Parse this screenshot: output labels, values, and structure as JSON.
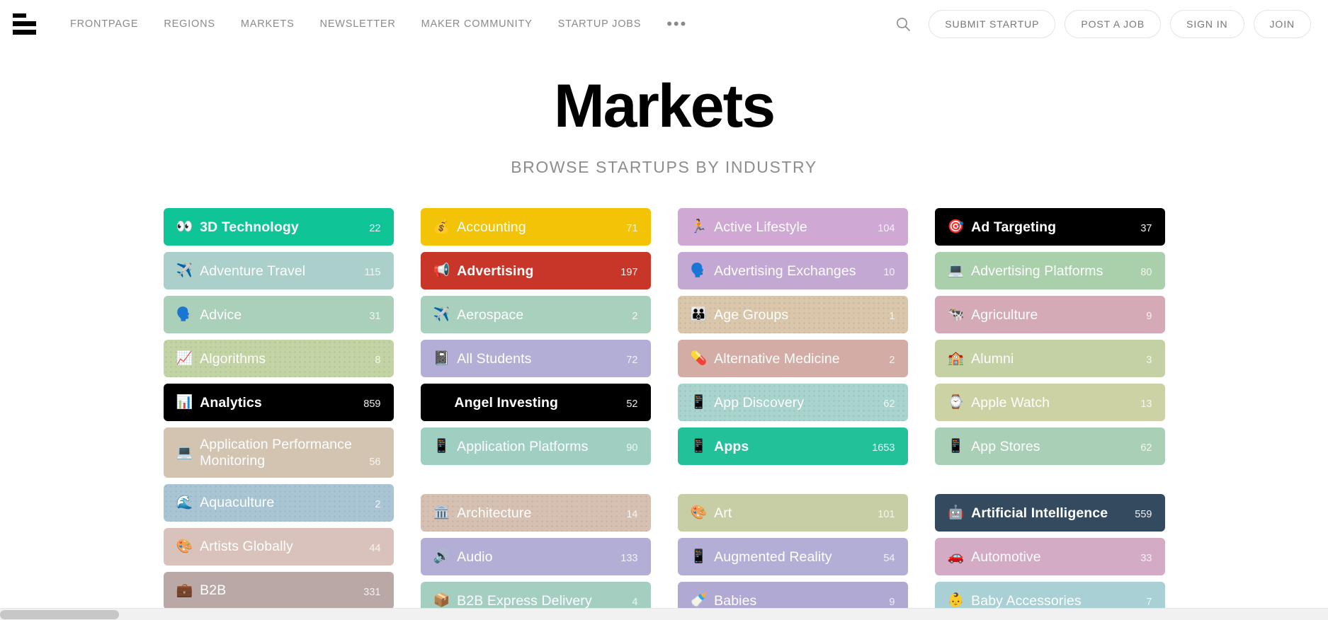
{
  "header": {
    "menu_icon": "hamburger-icon",
    "nav": [
      {
        "label": "FRONTPAGE"
      },
      {
        "label": "REGIONS"
      },
      {
        "label": "MARKETS"
      },
      {
        "label": "NEWSLETTER"
      },
      {
        "label": "MAKER COMMUNITY"
      },
      {
        "label": "STARTUP JOBS"
      }
    ],
    "more_label": "•••",
    "search_icon": "search-icon",
    "actions": [
      {
        "label": "SUBMIT STARTUP"
      },
      {
        "label": "POST A JOB"
      },
      {
        "label": "SIGN IN"
      },
      {
        "label": "JOIN"
      }
    ]
  },
  "page": {
    "title": "Markets",
    "subtitle": "BROWSE STARTUPS BY INDUSTRY"
  },
  "columns": [
    {
      "cards": [
        {
          "emoji": "👀",
          "icon": "eyes-icon",
          "label": "3D Technology",
          "count": "22",
          "bg": "#0fc496",
          "bold": true,
          "dotted": false,
          "spaced": false
        },
        {
          "emoji": "✈️",
          "icon": "airplane-icon",
          "label": "Adventure Travel",
          "count": "115",
          "bg": "#abcfca",
          "bold": false,
          "dotted": false,
          "spaced": false
        },
        {
          "emoji": "🗣️",
          "icon": "speaking-head-icon",
          "label": "Advice",
          "count": "31",
          "bg": "#abd0b9",
          "bold": false,
          "dotted": false,
          "spaced": false
        },
        {
          "emoji": "📈",
          "icon": "chart-increasing-icon",
          "label": "Algorithms",
          "count": "8",
          "bg": "#c2d3a4",
          "bold": false,
          "dotted": true,
          "spaced": false
        },
        {
          "emoji": "📊",
          "icon": "bar-chart-icon",
          "label": "Analytics",
          "count": "859",
          "bg": "#000000",
          "bold": true,
          "dotted": false,
          "spaced": false
        },
        {
          "emoji": "💻",
          "icon": "laptop-icon",
          "label": "Application Performance Monitoring",
          "count": "56",
          "bg": "#d3c3b1",
          "bold": false,
          "dotted": false,
          "spaced": false
        },
        {
          "emoji": "🌊",
          "icon": "wave-icon",
          "label": "Aquaculture",
          "count": "2",
          "bg": "#a9c5d4",
          "bold": false,
          "dotted": true,
          "spaced": false
        },
        {
          "emoji": "🎨",
          "icon": "palette-icon",
          "label": "Artists Globally",
          "count": "44",
          "bg": "#d9c2bc",
          "bold": false,
          "dotted": false,
          "spaced": false
        },
        {
          "emoji": "💼",
          "icon": "briefcase-icon",
          "label": "B2B",
          "count": "331",
          "bg": "#b9a8a5",
          "bold": false,
          "dotted": false,
          "spaced": false
        }
      ]
    },
    {
      "cards": [
        {
          "emoji": "💰",
          "icon": "money-bag-icon",
          "label": "Accounting",
          "count": "71",
          "bg": "#f2c307",
          "bold": false,
          "dotted": false,
          "spaced": false
        },
        {
          "emoji": "📢",
          "icon": "megaphone-icon",
          "label": "Advertising",
          "count": "197",
          "bg": "#c8362a",
          "bold": true,
          "dotted": false,
          "spaced": false
        },
        {
          "emoji": "✈️",
          "icon": "airplane-icon",
          "label": "Aerospace",
          "count": "2",
          "bg": "#a9cfbd",
          "bold": false,
          "dotted": false,
          "spaced": false
        },
        {
          "emoji": "📓",
          "icon": "notebook-icon",
          "label": "All Students",
          "count": "72",
          "bg": "#b3aed6",
          "bold": false,
          "dotted": false,
          "spaced": false
        },
        {
          "emoji": "😇",
          "icon": "angel-face-icon",
          "label": "Angel Investing",
          "count": "52",
          "bg": "#000000",
          "bold": true,
          "dotted": false,
          "spaced": false
        },
        {
          "emoji": "📱",
          "icon": "mobile-phone-icon",
          "label": "Application Platforms",
          "count": "90",
          "bg": "#9fcfc0",
          "bold": false,
          "dotted": false,
          "spaced": false
        },
        {
          "emoji": "🏛️",
          "icon": "classical-building-icon",
          "label": "Architecture",
          "count": "14",
          "bg": "#d6c0b2",
          "bold": false,
          "dotted": true,
          "spaced": true
        },
        {
          "emoji": "🔊",
          "icon": "speaker-icon",
          "label": "Audio",
          "count": "133",
          "bg": "#b3aed6",
          "bold": false,
          "dotted": false,
          "spaced": false
        },
        {
          "emoji": "📦",
          "icon": "package-icon",
          "label": "B2B Express Delivery",
          "count": "4",
          "bg": "#a4cfc0",
          "bold": false,
          "dotted": false,
          "spaced": false
        }
      ]
    },
    {
      "cards": [
        {
          "emoji": "🏃",
          "icon": "runner-icon",
          "label": "Active Lifestyle",
          "count": "104",
          "bg": "#cfa8d4",
          "bold": false,
          "dotted": false,
          "spaced": false
        },
        {
          "emoji": "🗣️",
          "icon": "speaking-head-icon",
          "label": "Advertising Exchanges",
          "count": "10",
          "bg": "#c3a8d4",
          "bold": false,
          "dotted": false,
          "spaced": false
        },
        {
          "emoji": "👪",
          "icon": "family-icon",
          "label": "Age Groups",
          "count": "1",
          "bg": "#d9c6ab",
          "bold": false,
          "dotted": true,
          "spaced": false
        },
        {
          "emoji": "💊",
          "icon": "pill-icon",
          "label": "Alternative Medicine",
          "count": "2",
          "bg": "#d3aca6",
          "bold": false,
          "dotted": false,
          "spaced": false
        },
        {
          "emoji": "📱",
          "icon": "mobile-phone-icon",
          "label": "App Discovery",
          "count": "62",
          "bg": "#a9d3cd",
          "bold": false,
          "dotted": true,
          "spaced": false
        },
        {
          "emoji": "📱",
          "icon": "mobile-phone-icon",
          "label": "Apps",
          "count": "1653",
          "bg": "#22c19a",
          "bold": true,
          "dotted": false,
          "spaced": false
        },
        {
          "emoji": "🎨",
          "icon": "palette-icon",
          "label": "Art",
          "count": "101",
          "bg": "#c7cda4",
          "bold": false,
          "dotted": false,
          "spaced": true
        },
        {
          "emoji": "📱",
          "icon": "mobile-phone-icon",
          "label": "Augmented Reality",
          "count": "54",
          "bg": "#b3aed6",
          "bold": false,
          "dotted": false,
          "spaced": false
        },
        {
          "emoji": "🍼",
          "icon": "baby-bottle-icon",
          "label": "Babies",
          "count": "9",
          "bg": "#afa9d4",
          "bold": false,
          "dotted": false,
          "spaced": false
        }
      ]
    },
    {
      "cards": [
        {
          "emoji": "🎯",
          "icon": "dart-icon",
          "label": "Ad Targeting",
          "count": "37",
          "bg": "#000000",
          "bold": true,
          "dotted": false,
          "spaced": false
        },
        {
          "emoji": "💻",
          "icon": "laptop-icon",
          "label": "Advertising Platforms",
          "count": "80",
          "bg": "#a9d0ab",
          "bold": false,
          "dotted": false,
          "spaced": false
        },
        {
          "emoji": "🐄",
          "icon": "cow-icon",
          "label": "Agriculture",
          "count": "9",
          "bg": "#d4aab6",
          "bold": false,
          "dotted": false,
          "spaced": false
        },
        {
          "emoji": "🏫",
          "icon": "school-icon",
          "label": "Alumni",
          "count": "3",
          "bg": "#c3d1a4",
          "bold": false,
          "dotted": false,
          "spaced": false
        },
        {
          "emoji": "⌚",
          "icon": "watch-icon",
          "label": "Apple Watch",
          "count": "13",
          "bg": "#cdd2a4",
          "bold": false,
          "dotted": false,
          "spaced": false
        },
        {
          "emoji": "📱",
          "icon": "mobile-phone-icon",
          "label": "App Stores",
          "count": "62",
          "bg": "#a9d0b6",
          "bold": false,
          "dotted": false,
          "spaced": false
        },
        {
          "emoji": "🤖",
          "icon": "robot-icon",
          "label": "Artificial Intelligence",
          "count": "559",
          "bg": "#334a5f",
          "bold": true,
          "dotted": false,
          "spaced": true
        },
        {
          "emoji": "🚗",
          "icon": "car-icon",
          "label": "Automotive",
          "count": "33",
          "bg": "#d4abc4",
          "bold": false,
          "dotted": false,
          "spaced": false
        },
        {
          "emoji": "👶",
          "icon": "baby-icon",
          "label": "Baby Accessories",
          "count": "7",
          "bg": "#a9d0d4",
          "bold": false,
          "dotted": false,
          "spaced": false
        }
      ]
    }
  ],
  "scrollbar": {
    "orientation": "horizontal"
  }
}
